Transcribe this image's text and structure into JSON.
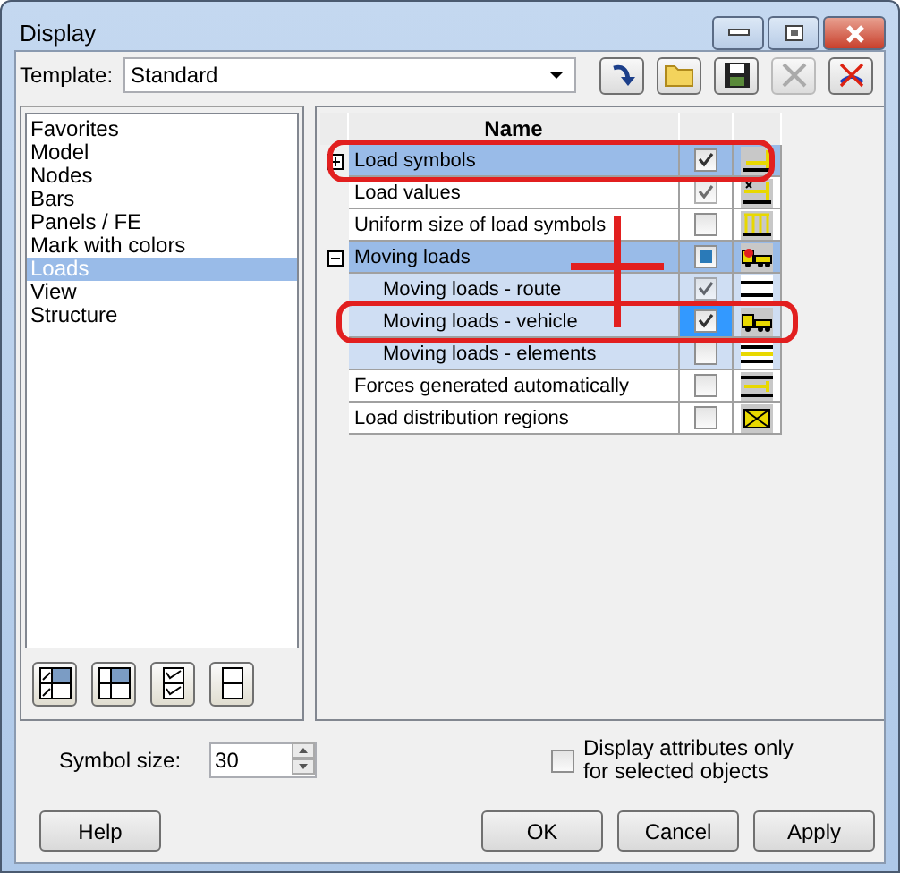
{
  "window": {
    "title": "Display"
  },
  "template": {
    "label": "Template:",
    "value": "Standard"
  },
  "categories": [
    {
      "label": "Favorites",
      "selected": false
    },
    {
      "label": "Model",
      "selected": false
    },
    {
      "label": "Nodes",
      "selected": false
    },
    {
      "label": "Bars",
      "selected": false
    },
    {
      "label": "Panels / FE",
      "selected": false
    },
    {
      "label": "Mark with colors",
      "selected": false
    },
    {
      "label": "Loads",
      "selected": true
    },
    {
      "label": "View",
      "selected": false
    },
    {
      "label": "Structure",
      "selected": false
    }
  ],
  "tree": {
    "header": "Name",
    "rows": [
      {
        "label": "Load symbols",
        "expanded": false,
        "selected": true,
        "focused": false,
        "checked": true,
        "partial": false,
        "kind": "load"
      },
      {
        "label": "Load values",
        "selected": false,
        "focused": false,
        "checked": true,
        "partial": false,
        "kind": "values"
      },
      {
        "label": "Uniform size of load symbols",
        "selected": false,
        "focused": false,
        "checked": false,
        "partial": false,
        "kind": "uniform"
      },
      {
        "label": "Moving loads",
        "expanded": true,
        "selected": true,
        "focused": false,
        "checked": false,
        "partial": true,
        "kind": "vehicle",
        "children": [
          {
            "label": "Moving loads - route",
            "selected": false,
            "focused": false,
            "checked": true,
            "partial": false,
            "kind": "lines"
          },
          {
            "label": "Moving loads - vehicle",
            "selected": false,
            "focused": true,
            "checked": true,
            "partial": false,
            "kind": "vehicle"
          },
          {
            "label": "Moving loads - elements",
            "selected": false,
            "focused": false,
            "checked": false,
            "partial": false,
            "kind": "elements"
          }
        ]
      },
      {
        "label": "Forces generated automatically",
        "selected": false,
        "focused": false,
        "checked": false,
        "partial": false,
        "kind": "forces"
      },
      {
        "label": "Load distribution regions",
        "selected": false,
        "focused": false,
        "checked": false,
        "partial": false,
        "kind": "region"
      }
    ]
  },
  "symbol_size": {
    "label": "Symbol size:",
    "value": "30"
  },
  "only_selected": {
    "label": "Display attributes only for selected objects",
    "checked": false
  },
  "buttons": {
    "left": [
      "Help"
    ],
    "right": [
      "OK",
      "Cancel",
      "Apply"
    ]
  }
}
